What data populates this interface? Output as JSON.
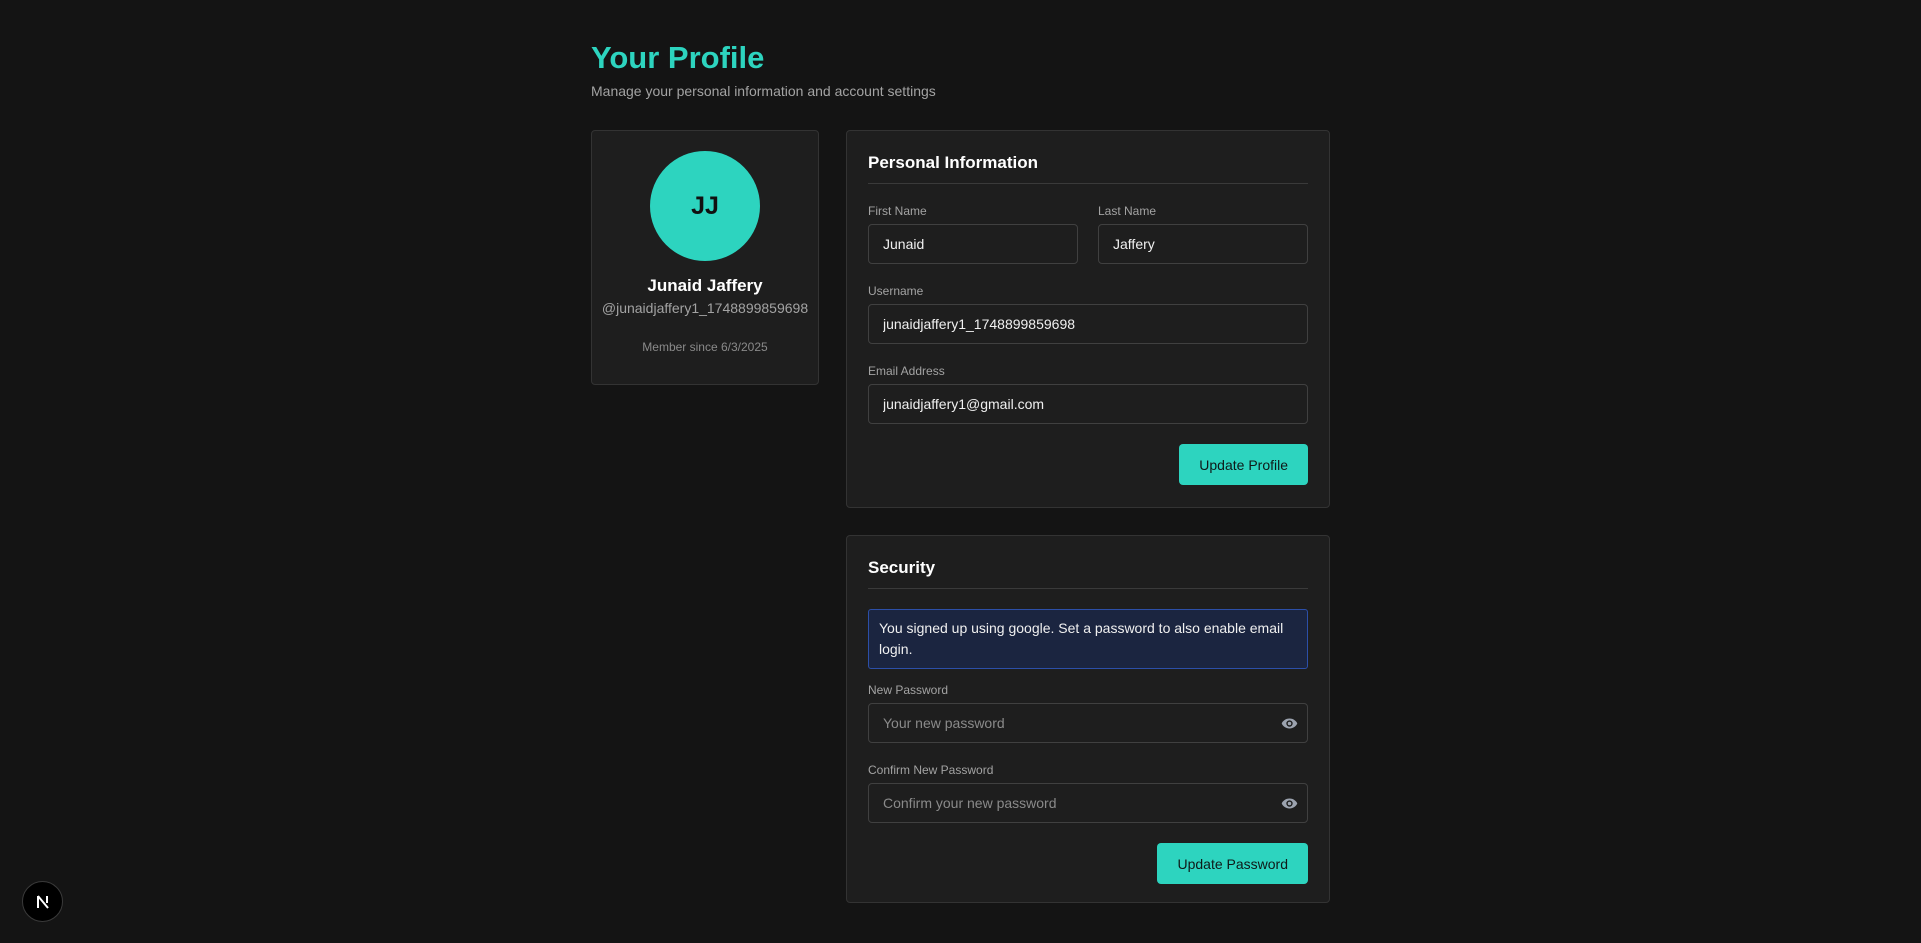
{
  "header": {
    "title": "Your Profile",
    "subtitle": "Manage your personal information and account settings"
  },
  "profile": {
    "initials": "JJ",
    "name": "Junaid Jaffery",
    "username": "@junaidjaffery1_1748899859698",
    "member_since": "Member since 6/3/2025"
  },
  "personal_info": {
    "title": "Personal Information",
    "first_name_label": "First Name",
    "first_name_value": "Junaid",
    "last_name_label": "Last Name",
    "last_name_value": "Jaffery",
    "username_label": "Username",
    "username_value": "junaidjaffery1_1748899859698",
    "email_label": "Email Address",
    "email_value": "junaidjaffery1@gmail.com",
    "update_button": "Update Profile"
  },
  "security": {
    "title": "Security",
    "notice": "You signed up using google. Set a password to also enable email login.",
    "new_password_label": "New Password",
    "new_password_placeholder": "Your new password",
    "confirm_password_label": "Confirm New Password",
    "confirm_password_placeholder": "Confirm your new password",
    "update_button": "Update Password"
  },
  "icons": {
    "password_toggle": "eye-icon",
    "dev_badge": "nextjs-logo-icon"
  },
  "colors": {
    "accent": "#2dd4bf",
    "background": "#141414",
    "card": "#1e1e1e",
    "notice_bg": "#1b2540",
    "notice_border": "#2c4fa8"
  }
}
